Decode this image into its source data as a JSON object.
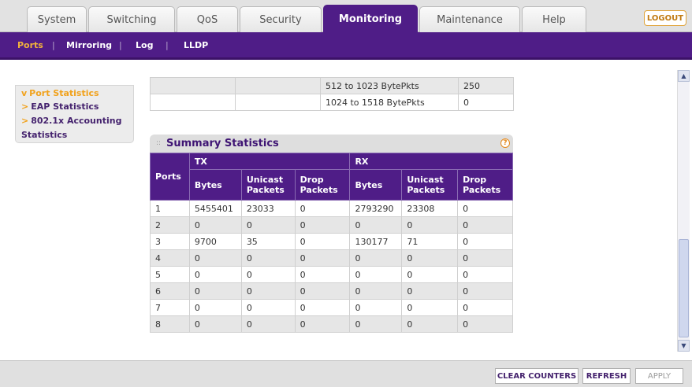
{
  "tabs": [
    {
      "label": "System"
    },
    {
      "label": "Switching"
    },
    {
      "label": "QoS"
    },
    {
      "label": "Security"
    },
    {
      "label": "Monitoring"
    },
    {
      "label": "Maintenance"
    },
    {
      "label": "Help"
    }
  ],
  "active_tab": "Monitoring",
  "logout_label": "LOGOUT",
  "subnav": [
    {
      "label": "Ports"
    },
    {
      "label": "Mirroring"
    },
    {
      "label": "Log"
    },
    {
      "label": "LLDP"
    }
  ],
  "subnav_separator": "|",
  "leftmenu": {
    "marker_active": "v",
    "marker": ">",
    "items": [
      {
        "label": "Port Statistics"
      },
      {
        "label": "EAP Statistics"
      },
      {
        "label": "802.1x Accounting"
      },
      {
        "label": "Statistics"
      }
    ]
  },
  "top_table": [
    {
      "label": "512 to 1023 BytePkts",
      "value": "250"
    },
    {
      "label": "1024 to 1518 BytePkts",
      "value": "0"
    }
  ],
  "summary": {
    "title": "Summary Statistics",
    "help_label": "?",
    "headers": {
      "ports": "Ports",
      "tx": "TX",
      "rx": "RX",
      "bytes": "Bytes",
      "unicast": "Unicast Packets",
      "drop": "Drop Packets"
    },
    "rows": [
      {
        "port": "1",
        "tx_bytes": "5455401",
        "tx_unicast": "23033",
        "tx_drop": "0",
        "rx_bytes": "2793290",
        "rx_unicast": "23308",
        "rx_drop": "0"
      },
      {
        "port": "2",
        "tx_bytes": "0",
        "tx_unicast": "0",
        "tx_drop": "0",
        "rx_bytes": "0",
        "rx_unicast": "0",
        "rx_drop": "0"
      },
      {
        "port": "3",
        "tx_bytes": "9700",
        "tx_unicast": "35",
        "tx_drop": "0",
        "rx_bytes": "130177",
        "rx_unicast": "71",
        "rx_drop": "0"
      },
      {
        "port": "4",
        "tx_bytes": "0",
        "tx_unicast": "0",
        "tx_drop": "0",
        "rx_bytes": "0",
        "rx_unicast": "0",
        "rx_drop": "0"
      },
      {
        "port": "5",
        "tx_bytes": "0",
        "tx_unicast": "0",
        "tx_drop": "0",
        "rx_bytes": "0",
        "rx_unicast": "0",
        "rx_drop": "0"
      },
      {
        "port": "6",
        "tx_bytes": "0",
        "tx_unicast": "0",
        "tx_drop": "0",
        "rx_bytes": "0",
        "rx_unicast": "0",
        "rx_drop": "0"
      },
      {
        "port": "7",
        "tx_bytes": "0",
        "tx_unicast": "0",
        "tx_drop": "0",
        "rx_bytes": "0",
        "rx_unicast": "0",
        "rx_drop": "0"
      },
      {
        "port": "8",
        "tx_bytes": "0",
        "tx_unicast": "0",
        "tx_drop": "0",
        "rx_bytes": "0",
        "rx_unicast": "0",
        "rx_drop": "0"
      }
    ]
  },
  "buttons": {
    "clear_counters": "CLEAR COUNTERS",
    "refresh": "REFRESH",
    "apply": "APPLY"
  },
  "colors": {
    "brand_purple": "#4f1d87",
    "accent_orange": "#f1a21c"
  },
  "icons": {
    "scroll_up": "chevron-up-icon",
    "scroll_down": "chevron-down-icon",
    "help": "help-icon"
  }
}
